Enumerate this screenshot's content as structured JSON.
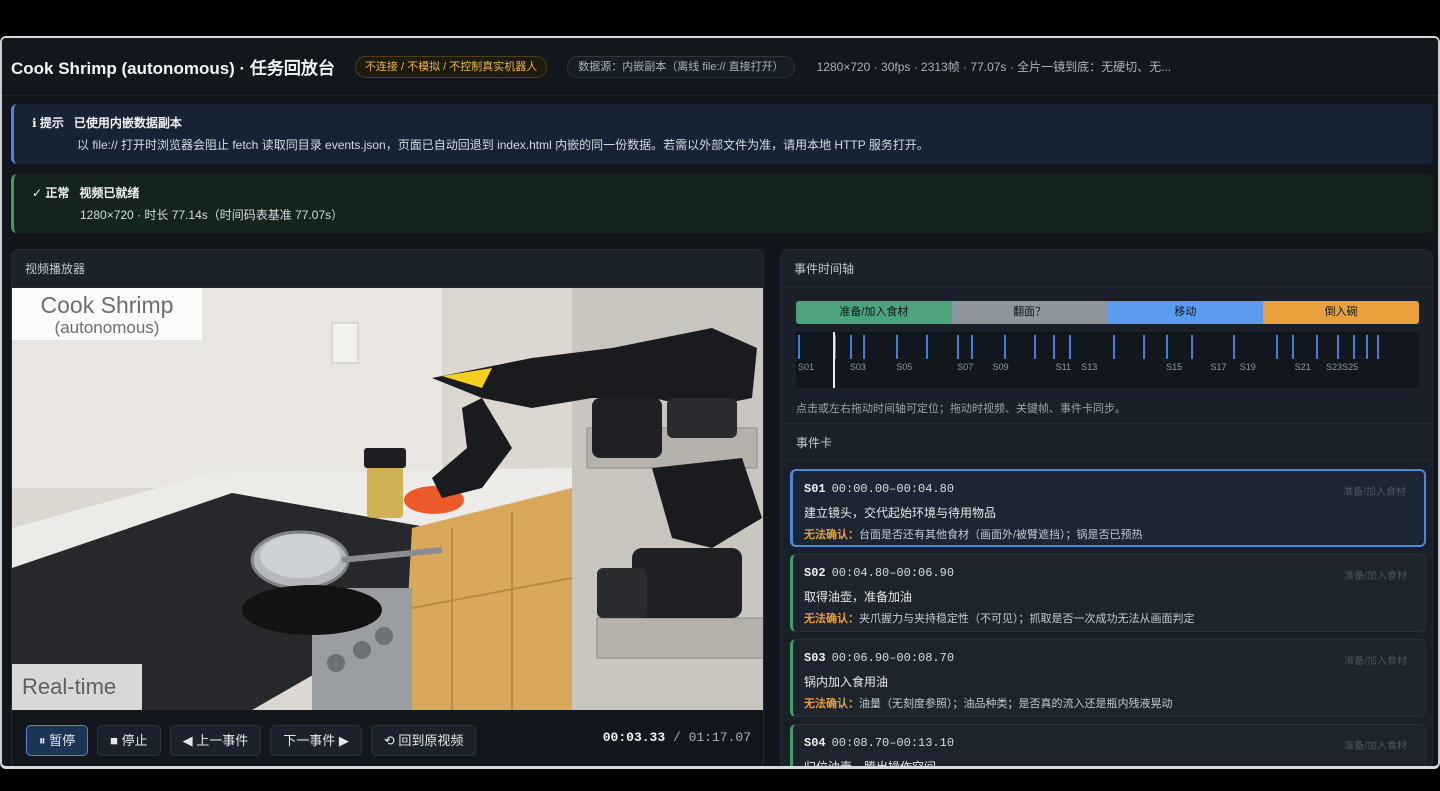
{
  "header": {
    "title": "Cook Shrimp (autonomous) · 任务回放台",
    "safety_badge": "不连接 / 不模拟 / 不控制真实机器人",
    "source_badge": "数据源：内嵌副本（离线 file:// 直接打开）",
    "meta": "1280×720 · 30fps · 2313帧 · 77.07s · 全片一镜到底：无硬切、无..."
  },
  "alerts": {
    "info": {
      "tag": "ℹ 提示",
      "title": "已使用内嵌数据副本",
      "body": "以 file:// 打开时浏览器会阻止 fetch 读取同目录 events.json，页面已自动回退到 index.html 内嵌的同一份数据。若需以外部文件为准，请用本地 HTTP 服务打开。",
      "color": "#4f86d9"
    },
    "ok": {
      "tag": "✓ 正常",
      "title": "视频已就绪",
      "body": "1280×720 · 时长 77.14s（时间码表基准 77.07s）",
      "color": "#3f9d65"
    }
  },
  "video_panel": {
    "title": "视频播放器",
    "overlay_title_1": "Cook Shrimp",
    "overlay_title_2": "(autonomous)",
    "overlay_corner": "Real-time",
    "controls": {
      "pause": "⏸ 暂停",
      "stop": "■ 停止",
      "prev": "◀ 上一事件",
      "next": "下一事件 ▶",
      "back": "⟲ 回到原视频"
    },
    "time_current": "00:03.33",
    "time_total": "/ 01:17.07",
    "playback_fraction": 0.043
  },
  "timeline_panel": {
    "title": "事件时间轴",
    "phases": [
      {
        "label": "准备/加入食材",
        "color": "#4aa37a",
        "fraction": 0.25
      },
      {
        "label": "翻面？",
        "color": "#8e959d",
        "fraction": 0.25
      },
      {
        "label": "移动",
        "color": "#5b9cf0",
        "fraction": 0.25
      },
      {
        "label": "倒入碗",
        "color": "#e8a03a",
        "fraction": 0.25
      }
    ],
    "total_seconds": 77.07,
    "event_starts": [
      0.0,
      4.8,
      6.9,
      8.7,
      13.1,
      17.0,
      21.2,
      23.0,
      27.4,
      31.4,
      34.0,
      36.1,
      41.9,
      45.9,
      49.0,
      52.3,
      57.9,
      63.6,
      65.8,
      69.0,
      71.7,
      73.9,
      75.6,
      77.1
    ],
    "labeled_ticks": [
      {
        "label": "S01",
        "t": 0.0
      },
      {
        "label": "S03",
        "t": 6.9
      },
      {
        "label": "S05",
        "t": 13.1
      },
      {
        "label": "S07",
        "t": 21.2
      },
      {
        "label": "S09",
        "t": 25.9
      },
      {
        "label": "S11",
        "t": 34.3
      },
      {
        "label": "S13",
        "t": 37.7
      },
      {
        "label": "S15",
        "t": 49.0
      },
      {
        "label": "S17",
        "t": 54.9
      },
      {
        "label": "S19",
        "t": 58.8
      },
      {
        "label": "S21",
        "t": 66.1
      },
      {
        "label": "S23S25",
        "t": 70.3
      }
    ],
    "playhead_seconds": 3.33,
    "hint": "点击或左右拖动时间轴可定位；拖动时视频、关键帧、事件卡同步。"
  },
  "event_cards": {
    "title": "事件卡",
    "warn_label": "无法确认：",
    "cards": [
      {
        "id": "S01",
        "range": "00:00.00–00:04.80",
        "phase": "准备/加入食材",
        "title": "建立镜头，交代起始环境与待用物品",
        "note": "台面是否还有其他食材（画面外/被臂遮挡）；锅是否已预热",
        "active": true
      },
      {
        "id": "S02",
        "range": "00:04.80–00:06.90",
        "phase": "准备/加入食材",
        "title": "取得油壶，准备加油",
        "note": "夹爪握力与夹持稳定性（不可见）；抓取是否一次成功无法从画面判定",
        "active": false
      },
      {
        "id": "S03",
        "range": "00:06.90–00:08.70",
        "phase": "准备/加入食材",
        "title": "锅内加入食用油",
        "note": "油量（无刻度参照）；油品种类；是否真的流入还是瓶内残液晃动",
        "active": false
      },
      {
        "id": "S04",
        "range": "00:08.70–00:13.10",
        "phase": "准备/加入食材",
        "title": "归位油壶，腾出操作空间",
        "note": "",
        "active": false
      }
    ]
  }
}
